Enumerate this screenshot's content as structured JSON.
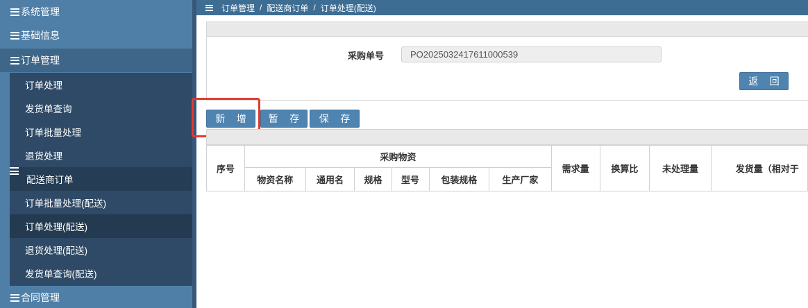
{
  "sidebar": {
    "top_items": [
      {
        "label": "系统管理"
      },
      {
        "label": "基础信息"
      },
      {
        "label": "订单管理"
      }
    ],
    "order_sub": [
      {
        "label": "订单处理"
      },
      {
        "label": "发货单查询"
      },
      {
        "label": "订单批量处理"
      },
      {
        "label": "退货处理"
      }
    ],
    "distributor_group": {
      "label": "配送商订单"
    },
    "distributor_sub": [
      {
        "label": "订单批量处理(配送)"
      },
      {
        "label": "订单处理(配送)"
      },
      {
        "label": "退货处理(配送)"
      },
      {
        "label": "发货单查询(配送)"
      }
    ],
    "contract": {
      "label": "合同管理"
    }
  },
  "breadcrumb": {
    "items": [
      "订单管理",
      "配送商订单",
      "订单处理(配送)"
    ],
    "separator": "/"
  },
  "form": {
    "po_label": "采购单号",
    "po_value": "PO2025032417611000539"
  },
  "buttons": {
    "back": "返 回",
    "add": "新 增",
    "temp_save": "暂 存",
    "save": "保 存"
  },
  "table": {
    "group_header": "采购物资",
    "columns": {
      "seq": "序号",
      "name": "物资名称",
      "generic": "通用名",
      "spec": "规格",
      "model": "型号",
      "package": "包装规格",
      "maker": "生产厂家",
      "demand": "需求量",
      "ratio": "换算比",
      "unprocessed": "未处理量",
      "ship_qty": "发货量（相对于"
    }
  },
  "colors": {
    "sidebar": "#4f7fa6",
    "submenu": "#2e4a66",
    "topbar": "#3e6d94",
    "button": "#4f84b1",
    "highlight": "#e53a2e"
  }
}
